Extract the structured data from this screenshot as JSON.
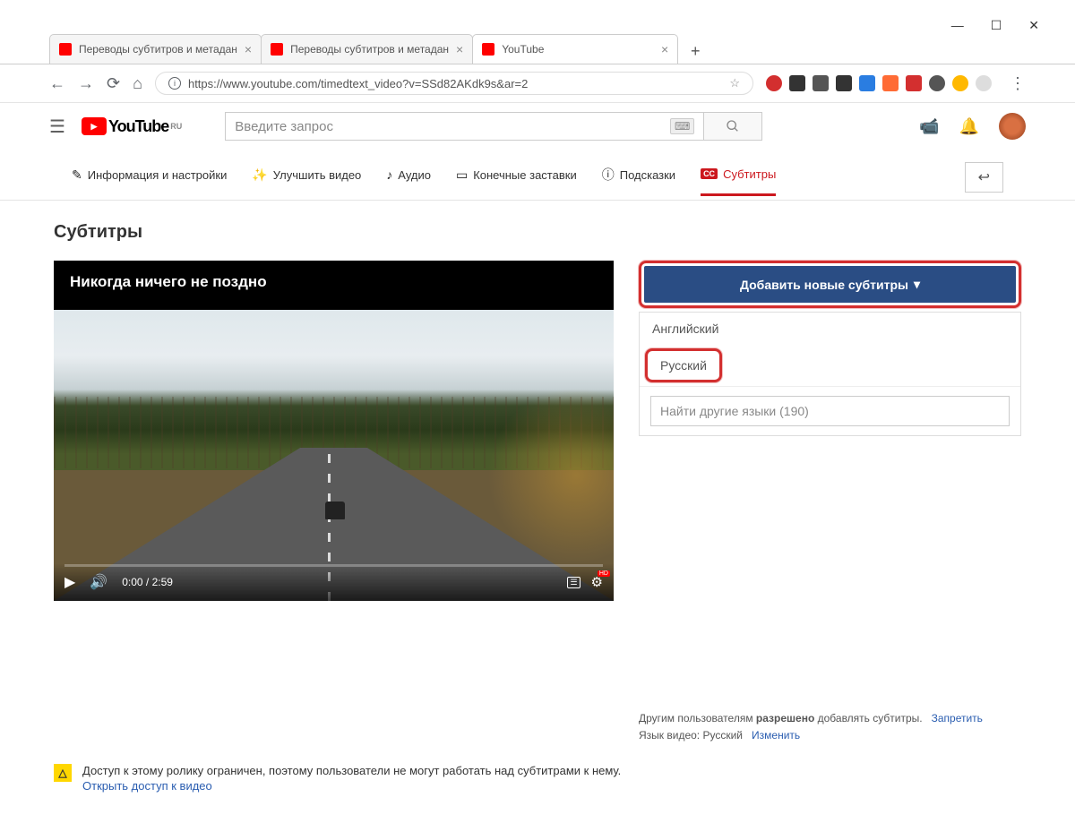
{
  "window": {
    "minimize": "—",
    "maximize": "☐",
    "close": "✕"
  },
  "browser": {
    "tabs": [
      {
        "title": "Переводы субтитров и метадан"
      },
      {
        "title": "Переводы субтитров и метадан"
      },
      {
        "title": "YouTube"
      }
    ],
    "url": "https://www.youtube.com/timedtext_video?v=SSd82AKdk9s&ar=2"
  },
  "yt_header": {
    "logo_text": "YouTube",
    "logo_region": "RU",
    "search_placeholder": "Введите запрос"
  },
  "nav": {
    "info": "Информация и настройки",
    "improve": "Улучшить видео",
    "audio": "Аудио",
    "endscreens": "Конечные заставки",
    "cards": "Подсказки",
    "subtitles": "Субтитры"
  },
  "page": {
    "title": "Субтитры",
    "video_title": "Никогда ничего не поздно",
    "time": "0:00 / 2:59"
  },
  "subtitles_panel": {
    "add_button": "Добавить новые субтитры",
    "lang_english": "Английский",
    "lang_russian": "Русский",
    "search_placeholder": "Найти другие языки (190)",
    "permission_prefix": "Другим пользователям ",
    "permission_bold": "разрешено",
    "permission_suffix": " добавлять субтитры.",
    "forbid_link": "Запретить",
    "video_lang_label": "Язык видео: ",
    "video_lang_value": "Русский",
    "change_link": "Изменить"
  },
  "warning": {
    "text": "Доступ к этому ролику ограничен, поэтому пользователи не могут работать над субтитрами к нему.",
    "link": "Открыть доступ к видео"
  }
}
